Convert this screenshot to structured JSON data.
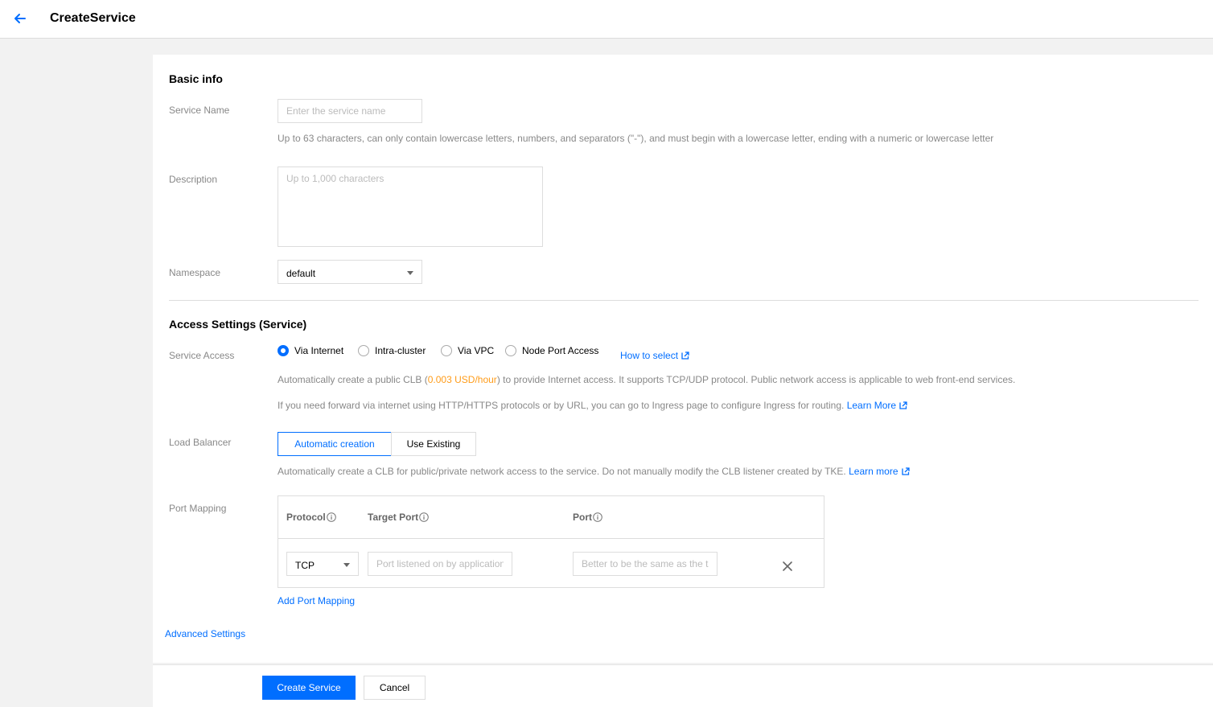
{
  "header": {
    "title": "CreateService"
  },
  "basic_info": {
    "title": "Basic info",
    "service_name": {
      "label": "Service Name",
      "placeholder": "Enter the service name",
      "value": "",
      "hint": "Up to 63 characters, can only contain lowercase letters, numbers, and separators (\"-\"), and must begin with a lowercase letter, ending with a numeric or lowercase letter"
    },
    "description": {
      "label": "Description",
      "placeholder": "Up to 1,000 characters",
      "value": ""
    },
    "namespace": {
      "label": "Namespace",
      "value": "default"
    }
  },
  "access": {
    "title": "Access Settings (Service)",
    "service_access": {
      "label": "Service Access",
      "options": [
        "Via Internet",
        "Intra-cluster",
        "Via VPC",
        "Node Port Access"
      ],
      "selected": "Via Internet",
      "how_to_select": "How to select"
    },
    "clb_hint": {
      "prefix": "Automatically create a public CLB (",
      "price": "0.003 USD/hour",
      "suffix": ") to provide Internet access. It supports TCP/UDP protocol. Public network access is applicable to web front-end services."
    },
    "ingress_hint": {
      "text": "If you need forward via internet using HTTP/HTTPS protocols or by URL, you can go to Ingress page to configure Ingress for routing.",
      "link": "Learn More"
    },
    "load_balancer": {
      "label": "Load Balancer",
      "options": [
        "Automatic creation",
        "Use Existing"
      ],
      "selected": "Automatic creation",
      "hint": "Automatically create a CLB for public/private network access to the service. Do not manually modify the CLB listener created by TKE.",
      "link": "Learn more"
    },
    "port_mapping": {
      "label": "Port Mapping",
      "columns": [
        "Protocol",
        "Target Port",
        "Port"
      ],
      "rows": [
        {
          "protocol": "TCP",
          "target_port_placeholder": "Port listened on by application",
          "port_placeholder": "Better to be the same as the target port"
        }
      ],
      "add_label": "Add Port Mapping"
    },
    "advanced": "Advanced Settings"
  },
  "footer": {
    "create_label": "Create Service",
    "cancel_label": "Cancel"
  },
  "colors": {
    "accent": "#006eff",
    "price": "#ff9c19"
  },
  "icons": [
    "arrow-left-icon",
    "external-link-icon",
    "info-icon",
    "close-icon",
    "caret-down-icon"
  ]
}
